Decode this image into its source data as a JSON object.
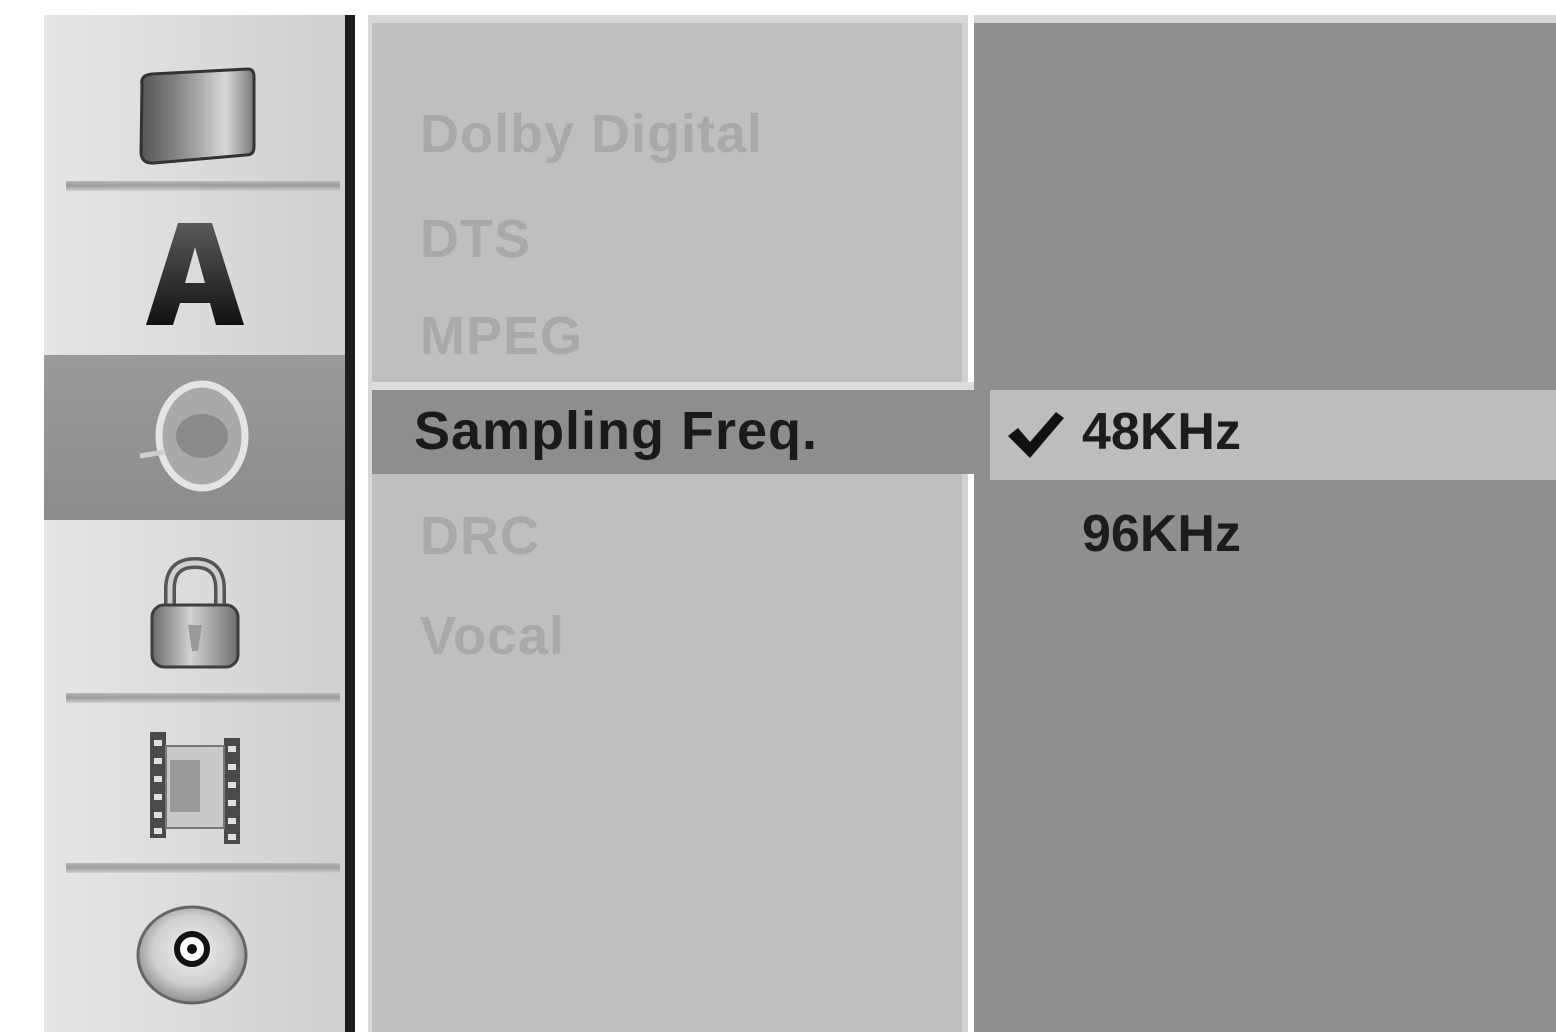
{
  "sidebar": {
    "icons": [
      {
        "name": "tv-icon",
        "selected": false
      },
      {
        "name": "language-icon",
        "selected": false
      },
      {
        "name": "audio-disc-icon",
        "selected": true
      },
      {
        "name": "lock-icon",
        "selected": false
      },
      {
        "name": "film-icon",
        "selected": false
      },
      {
        "name": "disc-icon",
        "selected": false
      }
    ],
    "language_glyph": "A"
  },
  "options": {
    "items": [
      {
        "label": "Dolby Digital"
      },
      {
        "label": "DTS"
      },
      {
        "label": "MPEG"
      },
      {
        "label": "Sampling Freq."
      },
      {
        "label": "DRC"
      },
      {
        "label": "Vocal"
      }
    ],
    "selected_index": 3
  },
  "values": {
    "items": [
      {
        "label": "48KHz",
        "checked": true
      },
      {
        "label": "96KHz",
        "checked": false
      }
    ],
    "check_glyph": "✔"
  },
  "colors": {
    "selected_bar": "#8e8e8e",
    "list_bg": "#bfbfbf",
    "panel_bg": "#8f8f8f",
    "inactive_text": "#a9a9a9",
    "active_text": "#1a1a1a"
  }
}
